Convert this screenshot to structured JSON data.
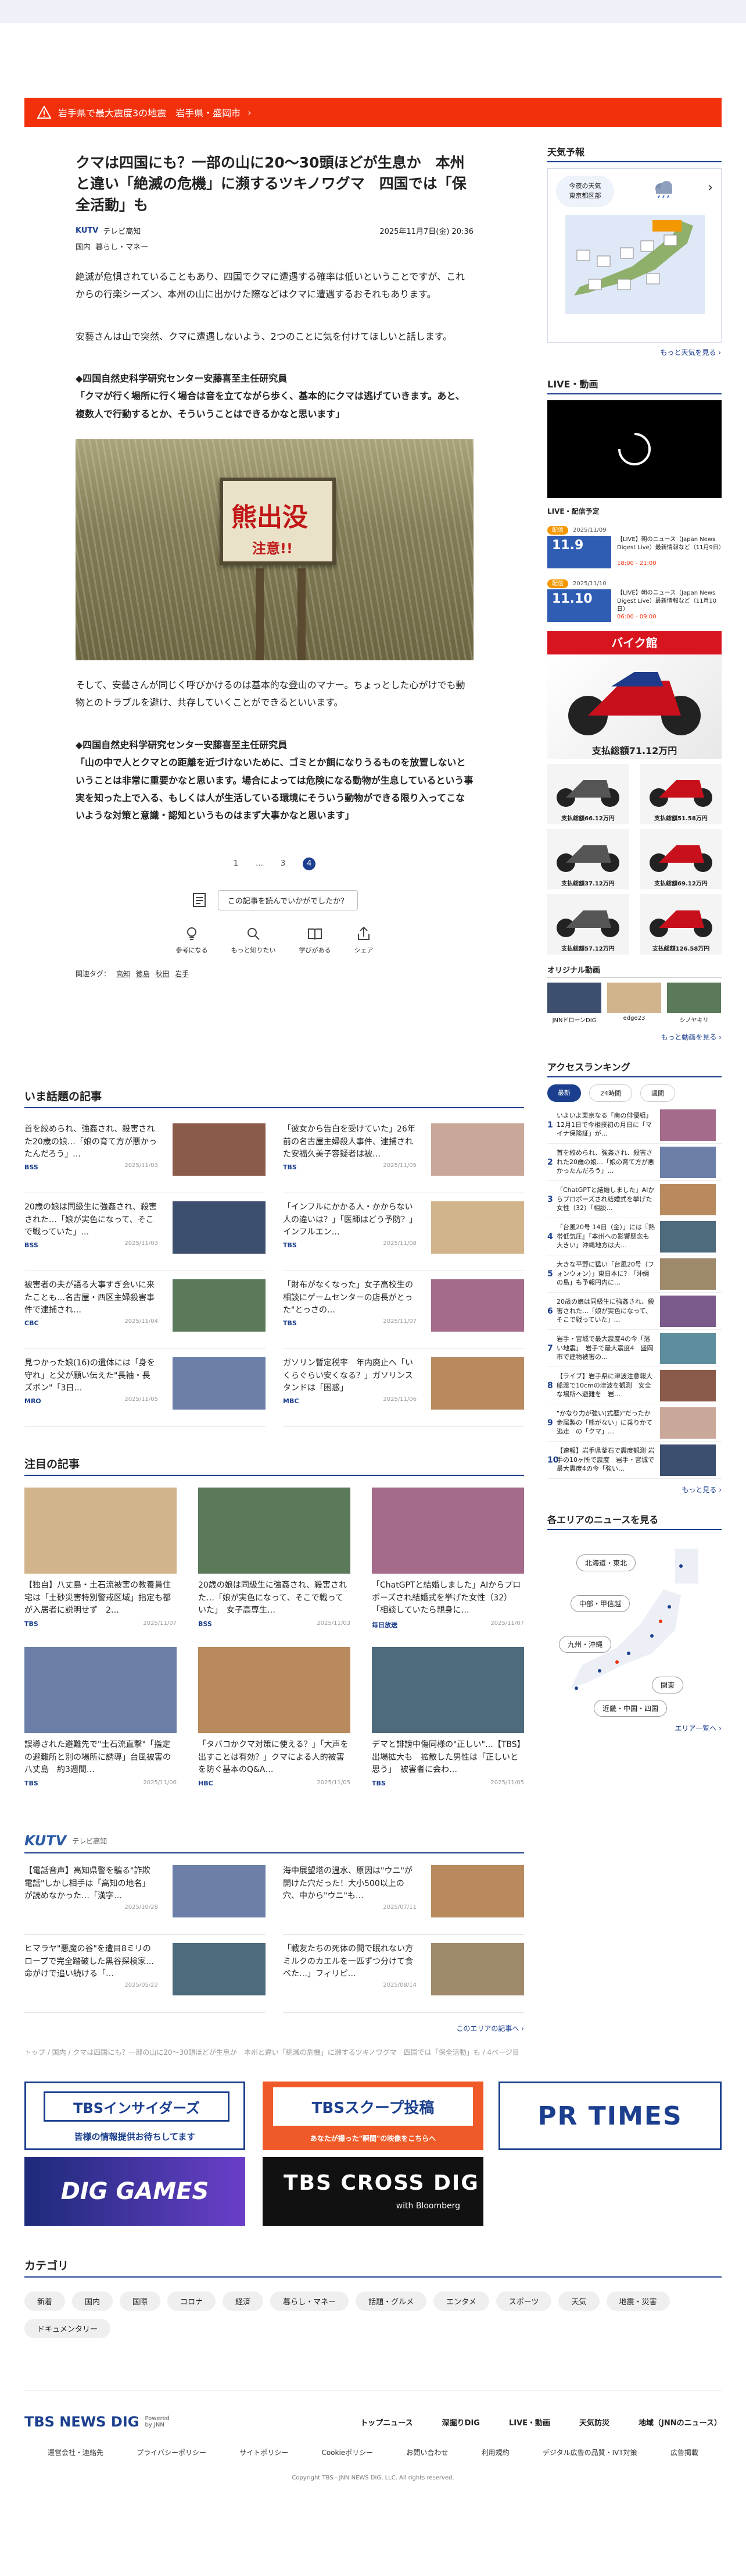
{
  "alert": {
    "text": "岩手県で最大震度3の地震　岩手県・盛岡市",
    "arrow": "›"
  },
  "article": {
    "title": "クマは四国にも？一部の山に20～30頭ほどが生息か　本州と違い「絶滅の危機」に瀕するツキノワグマ　四国では「保全活動」も",
    "source": "テレビ高知",
    "source_logo": "KUTV",
    "date": "2025年11月7日(金) 20:36",
    "categories": [
      "国内",
      "暮らし・マネー"
    ],
    "p1": "絶滅が危惧されていることもあり、四国でクマに遭遇する確率は低いということですが、これからの行楽シーズン、本州の山に出かけた際などはクマに遭遇するおそれもあります。",
    "p2": "安藝さんは山で突然、クマに遭遇しないよう、2つのことに気を付けてほしいと話します。",
    "p3": "◆四国自然史科学研究センター安藤喜至主任研究員\n「クマが行く場所に行く場合は音を立てながら歩く、基本的にクマは逃げていきます。あと、複数人で行動するとか、そういうことはできるかなと思います」",
    "photo_sign": "熊出没",
    "photo_sign2": "注意!!",
    "p4": "そして、安藝さんが同じく呼びかけるのは基本的な登山のマナー。ちょっとした心がけでも動物とのトラブルを避け、共存していくことができるといいます。",
    "p5": "◆四国自然史科学研究センター安藤喜至主任研究員\n「山の中で人とクマとの距離を近づけないために、ゴミとか餌になりうるものを放置しないということは非常に重要かなと思います。場合によっては危険になる動物が生息しているという事実を知った上で入る、もしくは人が生活している環境にそういう動物ができる限り入ってこないような対策と意識・認知というものはまず大事かなと思います」",
    "pages": [
      "1",
      "…",
      "3",
      "4"
    ],
    "feedback_q": "この記事を読んでいかがでしたか？",
    "reactions": [
      "参考になる",
      "もっと知りたい",
      "学びがある",
      "シェア"
    ],
    "tags_label": "関連タグ：",
    "tags": [
      "高知",
      "徳島",
      "秋田",
      "岩手"
    ]
  },
  "trending": {
    "heading": "いま話題の記事",
    "items": [
      {
        "t": "首を絞められ、強姦され、殺害された20歳の娘…「娘の育て方が悪かったんだろう」…",
        "b": "BSS",
        "d": "2025/11/03"
      },
      {
        "t": "「彼女から告白を受けていた」26年前の名古屋主婦殺人事件、逮捕された安福久美子容疑者は被…",
        "b": "TBS",
        "d": "2025/11/05"
      },
      {
        "t": "20歳の娘は同級生に強姦され、殺害された…「娘が実色になって、そこで戦っていた」…",
        "b": "BSS",
        "d": "2025/11/03"
      },
      {
        "t": "「インフルにかかる人・かからない人の違いは？」「医師はどう予防？」インフルエン…",
        "b": "TBS",
        "d": "2025/11/08"
      },
      {
        "t": "被害者の夫が語る大事すぎ会いに来たことも…名古屋・西区主婦殺害事件で逮捕され…",
        "b": "CBC",
        "d": "2025/11/04"
      },
      {
        "t": "「財布がなくなった」女子高校生の相談にゲームセンターの店長がとった\"とっさの…",
        "b": "TBS",
        "d": "2025/11/07"
      },
      {
        "t": "見つかった娘(16)の遺体には「身を守れ」と父が願い伝えた\"長袖・長ズボン\"「3日…",
        "b": "MRO",
        "d": "2025/11/05"
      },
      {
        "t": "ガソリン暫定税率　年内廃止へ「いくらぐらい安くなる？」ガソリンスタンドは「困惑」",
        "b": "MBC",
        "d": "2025/11/06"
      }
    ]
  },
  "featured": {
    "heading": "注目の記事",
    "items": [
      {
        "t": "【独自】八丈島・土石流被害の教養員住宅は「土砂災害特別警戒区域」指定も都が入居者に説明せず　2…",
        "b": "TBS",
        "d": "2025/11/07"
      },
      {
        "t": "20歳の娘は同級生に強姦され、殺害された…「娘が実色になって、そこで戦っていた」　女子高専生…",
        "b": "BSS",
        "d": "2025/11/03"
      },
      {
        "t": "「ChatGPTと結婚しました」AIからプロポーズされ結婚式を挙げた女性（32）「相談していたら親身に…",
        "b": "毎日放送",
        "d": "2025/11/07"
      },
      {
        "t": "誤導された避難先で\"土石流直撃\"「指定の避難所と別の場所に誘導」台風被害の八丈島　約3週間…",
        "b": "TBS",
        "d": "2025/11/06"
      },
      {
        "t": "「タバコかクマ対策に使える？」「大声を出すことは有効？」クマによる人的被害を防ぐ基本のQ&A…",
        "b": "HBC",
        "d": "2025/11/05"
      },
      {
        "t": "デマと誹謗中傷同様の\"正しい\"…【TBS】出場拡大も　拡散した男性は「正しいと思う」　被害者に会わ…",
        "b": "TBS",
        "d": "2025/11/05"
      }
    ]
  },
  "kutv": {
    "logo": "KUTV",
    "label": "テレビ高知",
    "items": [
      {
        "t": "【電話音声】高知県警を騙る\"詐欺電話\"しかし相手は「高知の地名」が読めなかった…「漢字…",
        "d": "2025/10/28"
      },
      {
        "t": "海中展望塔の温水、原因は\"ウニ\"が開けた穴だった！大小500以上の穴、中から\"ウニ\"も…",
        "d": "2025/07/11"
      },
      {
        "t": "ヒマラヤ\"悪魔の谷\"を遭目8ミリのロープで完全踏破した黒谷探検家…命がけで追い続ける「…",
        "d": "2025/05/22"
      },
      {
        "t": "「戦友たちの死体の間で眠れない方ミルクのカエルを一匹ずつ分けて食べた…」フィリピ…",
        "d": "2025/08/14"
      }
    ],
    "more": "このエリアの記事へ ›"
  },
  "crumb": "トップ / 国内 / クマは四国にも？一部の山に20～30頭ほどが生息か　本州と違い「絶滅の危機」に瀕するツキノワグマ　四国では「保全活動」も / 4ページ目",
  "banners": {
    "insider": "TBSインサイダーズ",
    "insider_sub": "皆様の情報提供お待ちしてます",
    "scoop": "TBSスクープ投稿",
    "scoop_sub": "あなたが撮った\"瞬間\"の映像をこちらへ",
    "prtimes": "PR TIMES",
    "dig": "DIG GAMES",
    "cross": "TBS CROSS DIG",
    "cross_sub": "with Bloomberg"
  },
  "categories": {
    "heading": "カテゴリ",
    "items": [
      "新着",
      "国内",
      "国際",
      "コロナ",
      "経済",
      "暮らし・マネー",
      "話題・グルメ",
      "エンタメ",
      "スポーツ",
      "天気",
      "地震・災害",
      "ドキュメンタリー"
    ]
  },
  "footer": {
    "logo": "TBS NEWS DIG",
    "powered": "Powered by JNN",
    "nav": [
      "トップニュース",
      "深掘りDIG",
      "LIVE・動画",
      "天気防災",
      "地域（JNNのニュース）"
    ],
    "links": [
      "運営会社・連絡先",
      "プライバシーポリシー",
      "サイトポリシー",
      "Cookieポリシー",
      "お問い合わせ",
      "利用規約",
      "デジタル広告の品質・IVT対策",
      "広告掲載"
    ],
    "copy": "Copyright TBS - JNN NEWS DIG, LLC. All rights reserved."
  },
  "side": {
    "weather_h": "天気予報",
    "weather_sub1": "今夜の天気",
    "weather_sub2": "東京都区部",
    "weather_more": "もっと天気を見る ›",
    "live_h": "LIVE・動画",
    "live_sched": "LIVE・配信予定",
    "sched": [
      {
        "tag": "配信",
        "date": "2025/11/09",
        "day": "11.9",
        "t": "【LIVE】朝のニュース（Japan News Digest Live）最新情報など（11月9日）",
        "time": "18:00 - 21:00"
      },
      {
        "tag": "配信",
        "date": "2025/11/10",
        "day": "11.10",
        "t": "【LIVE】朝のニュース（Japan News Digest Live）最新情報など（11月10日）",
        "time": "06:00 - 09:00"
      }
    ],
    "bike_h": "バイク館",
    "bike_top": "支払総額71.12万円",
    "bikes": [
      "支払総額66.12万円",
      "支払総額51.58万円",
      "支払総額37.12万円",
      "支払総額69.12万円",
      "支払総額57.12万円",
      "支払総額126.58万円"
    ],
    "orig_h": "オリジナル動画",
    "origs": [
      "JNNドローンDIG",
      "edge23",
      "シノヤキリ"
    ],
    "video_more": "もっと動画を見る ›",
    "rank_h": "アクセスランキング",
    "rank_tabs": [
      "最新",
      "24時間",
      "週間"
    ],
    "ranks": [
      "いよいよ東京なる「南の俳優組」12月1日で今相撲初の月日に「マイナ保険証」が…",
      "首を絞められ、強姦され、殺害された20歳の娘…「娘の育て方が悪かったんだろう」…",
      "「ChatGPTと結婚しました」AIからプロポーズされ結婚式を挙げた女性（32）「相談…",
      "「台風20号 14日（金）」には『熱帯低気圧』「本州への影響懸念も大きい」沖縄地方は大…",
      "大きな平野に猛い「台風20号（フォンウォン）」東日本に？「沖縄の島」も予報円内に…",
      "20歳の娘は同級生に強姦され、殺害された…「娘が実色になって、そこで戦っていた」…",
      "岩手・宮城で最大震度4の今「落い地震」　岩手で最大震度4　盛岡市で建物被害の…",
      "【ライブ】岩手県に津波注意報大船渡で10cmの津波を観測　安全な場所へ避難を　岩…",
      "\"かなり力が強い(式歴)\"だったか　金属製の「熊がない」に乗りかて逃走　の「クマ」…",
      "【速報】岩手県釜石で震度観測 岩手の10ヶ所で震度　岩手・宮城で最大震度4の今「強い…"
    ],
    "rank_more": "もっと見る ›",
    "area_h": "各エリアのニュースを見る",
    "areas": [
      "北海道・東北",
      "中部・甲信越",
      "九州・沖縄",
      "関東",
      "近畿・中国・四国"
    ],
    "area_more": "エリア一覧へ ›"
  },
  "colors": {
    "brand": "#1b3f8e",
    "alert": "#f2300c",
    "orange": "#f39800"
  }
}
